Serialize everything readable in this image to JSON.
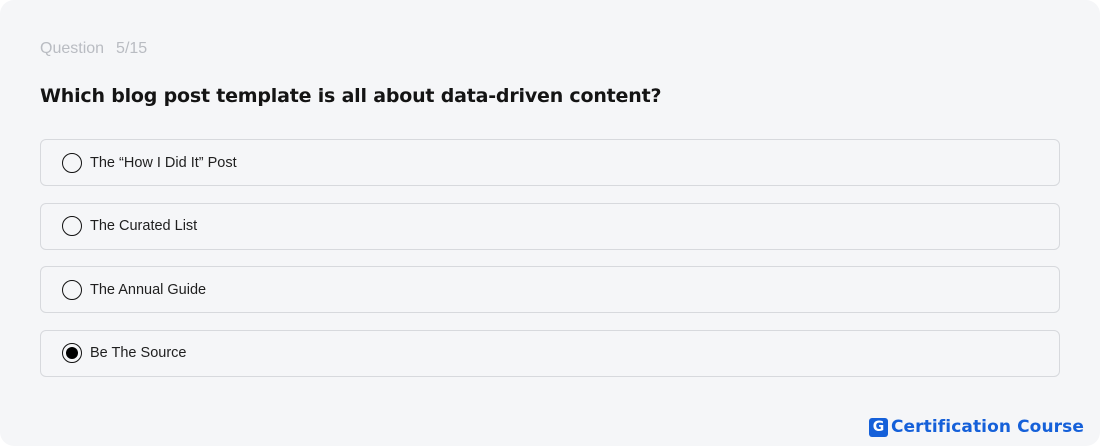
{
  "quiz": {
    "counter_label": "Question",
    "counter_value": "5/15",
    "question": "Which blog post template is all about data-driven content?",
    "options": [
      {
        "label": "The “How I Did It” Post",
        "selected": false
      },
      {
        "label": "The Curated List",
        "selected": false
      },
      {
        "label": "The Annual Guide",
        "selected": false
      },
      {
        "label": "Be The Source",
        "selected": true
      }
    ]
  },
  "brand": {
    "logo_letter": "G",
    "text": "Certification Course",
    "color": "#1560d9"
  },
  "colors": {
    "background": "#f5f6f8",
    "border": "#d7d9dd",
    "counter_text": "#b9bcc2"
  }
}
